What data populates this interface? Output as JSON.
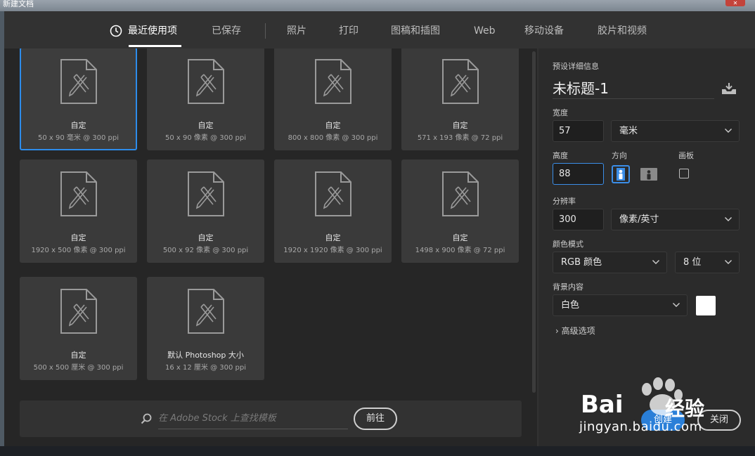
{
  "window": {
    "title": "新建文档"
  },
  "tabs": [
    {
      "label": "最近使用项",
      "active": true
    },
    {
      "label": "已保存"
    },
    {
      "label": "照片"
    },
    {
      "label": "打印"
    },
    {
      "label": "图稿和插图"
    },
    {
      "label": "Web"
    },
    {
      "label": "移动设备"
    },
    {
      "label": "胶片和视频"
    }
  ],
  "presets": [
    {
      "name": "自定",
      "spec": "50 x 90 毫米 @ 300 ppi",
      "selected": true
    },
    {
      "name": "自定",
      "spec": "50 x 90 像素 @ 300 ppi"
    },
    {
      "name": "自定",
      "spec": "800 x 800 像素 @ 300 ppi"
    },
    {
      "name": "自定",
      "spec": "571 x 193 像素 @ 72 ppi"
    },
    {
      "name": "自定",
      "spec": "1920 x 500 像素 @ 300 ppi"
    },
    {
      "name": "自定",
      "spec": "500 x 92 像素 @ 300 ppi"
    },
    {
      "name": "自定",
      "spec": "1920 x 1920 像素 @ 300 ppi"
    },
    {
      "name": "自定",
      "spec": "1498 x 900 像素 @ 72 ppi"
    },
    {
      "name": "自定",
      "spec": "500 x 500 厘米 @ 300 ppi"
    },
    {
      "name": "默认 Photoshop 大小",
      "spec": "16 x 12 厘米 @ 300 ppi"
    }
  ],
  "stock": {
    "placeholder": "在 Adobe Stock 上查找模板",
    "button": "前往"
  },
  "details": {
    "section_label": "预设详细信息",
    "doc_name": "未标题-1",
    "width_label": "宽度",
    "width_value": "57",
    "width_unit": "毫米",
    "height_label": "高度",
    "height_value": "88",
    "orientation_label": "方向",
    "artboard_label": "画板",
    "resolution_label": "分辨率",
    "resolution_value": "300",
    "resolution_unit": "像素/英寸",
    "color_mode_label": "颜色模式",
    "color_mode_value": "RGB 颜色",
    "bit_depth_value": "8 位",
    "background_label": "背景内容",
    "background_value": "白色",
    "background_color": "#ffffff",
    "advanced_label": "高级选项",
    "create_button": "创建",
    "close_button": "关闭"
  },
  "watermark": {
    "brand": "Bai",
    "brand_cn": "经验",
    "url": "jingyan.baidu.com"
  }
}
